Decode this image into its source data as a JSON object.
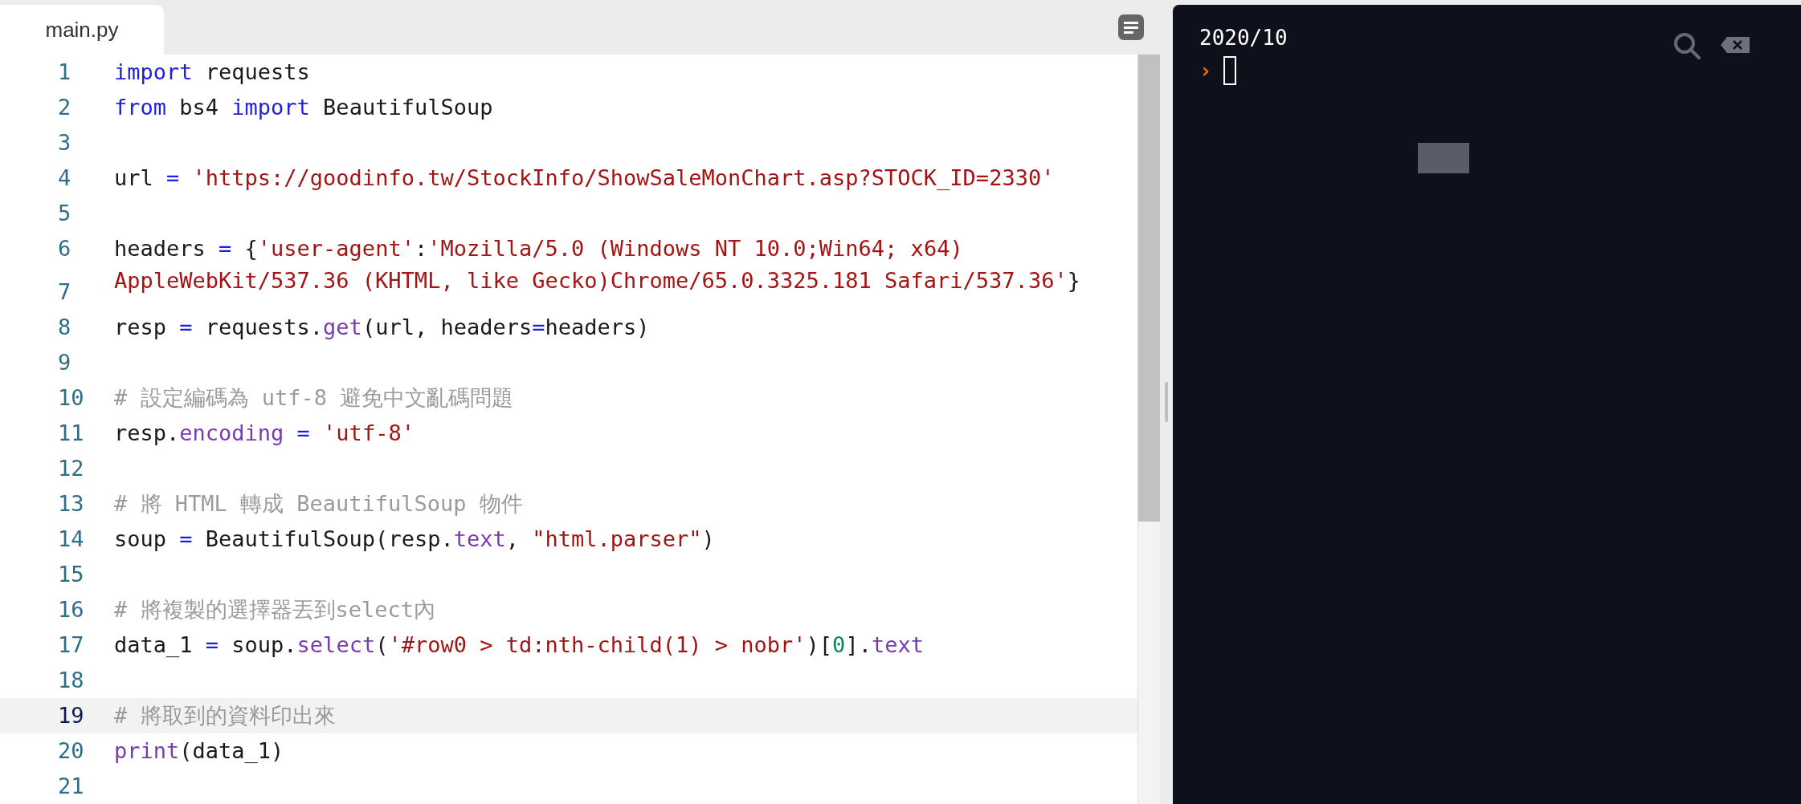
{
  "editor": {
    "tab": {
      "label": "main.py",
      "selected": true
    },
    "lines": [
      {
        "number": "1",
        "active": false,
        "tokens": [
          {
            "kind": "keyword",
            "text": "import"
          },
          {
            "kind": "plain",
            "text": " requests"
          }
        ]
      },
      {
        "number": "2",
        "active": false,
        "tokens": [
          {
            "kind": "keyword",
            "text": "from"
          },
          {
            "kind": "plain",
            "text": " bs4 "
          },
          {
            "kind": "keyword",
            "text": "import"
          },
          {
            "kind": "plain",
            "text": " BeautifulSoup"
          }
        ]
      },
      {
        "number": "3",
        "active": false
      },
      {
        "number": "4",
        "active": false,
        "tokens": [
          {
            "kind": "plain",
            "text": "url "
          },
          {
            "kind": "operator",
            "text": "="
          },
          {
            "kind": "string",
            "text": " 'https://goodinfo.tw/StockInfo/ShowSaleMonChart.asp?STOCK_ID=2330'"
          }
        ]
      },
      {
        "number": "5",
        "active": false
      },
      {
        "number": "6",
        "active": false,
        "tokens": [
          {
            "kind": "plain",
            "text": "headers "
          },
          {
            "kind": "operator",
            "text": "="
          },
          {
            "kind": "plain",
            "text": " {"
          },
          {
            "kind": "string",
            "text": "'user-agent'"
          },
          {
            "kind": "plain",
            "text": ":"
          },
          {
            "kind": "string",
            "text": "'Mozilla/5.0 (Windows NT 10.0;Win64; x64) AppleWebKit/537.36 (KHTML, like Gecko)Chrome/65.0.3325.181 Safari/537.36'"
          },
          {
            "kind": "plain",
            "text": "}"
          }
        ]
      },
      {
        "number": "7",
        "active": false
      },
      {
        "number": "8",
        "active": false,
        "tokens": [
          {
            "kind": "plain",
            "text": "resp "
          },
          {
            "kind": "operator",
            "text": "="
          },
          {
            "kind": "plain",
            "text": " requests."
          },
          {
            "kind": "property",
            "text": "get"
          },
          {
            "kind": "plain",
            "text": "(url, headers"
          },
          {
            "kind": "operator",
            "text": "="
          },
          {
            "kind": "plain",
            "text": "headers)"
          }
        ]
      },
      {
        "number": "9",
        "active": false
      },
      {
        "number": "10",
        "active": false,
        "tokens": [
          {
            "kind": "comment",
            "text": "# 設定編碼為 utf-8 避免中文亂碼問題"
          }
        ]
      },
      {
        "number": "11",
        "active": false,
        "tokens": [
          {
            "kind": "plain",
            "text": "resp."
          },
          {
            "kind": "property",
            "text": "encoding"
          },
          {
            "kind": "operator",
            "text": " = "
          },
          {
            "kind": "string",
            "text": "'utf-8'"
          }
        ]
      },
      {
        "number": "12",
        "active": false
      },
      {
        "number": "13",
        "active": false,
        "tokens": [
          {
            "kind": "comment",
            "text": "# 將 HTML 轉成 BeautifulSoup 物件"
          }
        ]
      },
      {
        "number": "14",
        "active": false,
        "tokens": [
          {
            "kind": "plain",
            "text": "soup "
          },
          {
            "kind": "operator",
            "text": "="
          },
          {
            "kind": "plain",
            "text": " BeautifulSoup(resp."
          },
          {
            "kind": "property",
            "text": "text"
          },
          {
            "kind": "plain",
            "text": ", "
          },
          {
            "kind": "string",
            "text": "\"html.parser\""
          },
          {
            "kind": "plain",
            "text": ")"
          }
        ]
      },
      {
        "number": "15",
        "active": false
      },
      {
        "number": "16",
        "active": false,
        "tokens": [
          {
            "kind": "comment",
            "text": "# 將複製的選擇器丟到select內"
          }
        ]
      },
      {
        "number": "17",
        "active": false,
        "tokens": [
          {
            "kind": "plain",
            "text": "data_1 "
          },
          {
            "kind": "operator",
            "text": "="
          },
          {
            "kind": "plain",
            "text": " soup."
          },
          {
            "kind": "property",
            "text": "select"
          },
          {
            "kind": "plain",
            "text": "("
          },
          {
            "kind": "string",
            "text": "'#row0 > td:nth-child(1) > nobr'"
          },
          {
            "kind": "plain",
            "text": ")["
          },
          {
            "kind": "number",
            "text": "0"
          },
          {
            "kind": "plain",
            "text": "]."
          },
          {
            "kind": "property",
            "text": "text"
          }
        ]
      },
      {
        "number": "18",
        "active": false
      },
      {
        "number": "19",
        "active": true,
        "tokens": [
          {
            "kind": "comment",
            "text": "# 將取到的資料印出來"
          }
        ]
      },
      {
        "number": "20",
        "active": false,
        "tokens": [
          {
            "kind": "property",
            "text": "print"
          },
          {
            "kind": "plain",
            "text": "(data_1)"
          }
        ]
      },
      {
        "number": "21",
        "active": false
      }
    ]
  },
  "console": {
    "output": "2020/10",
    "prompt": "›"
  }
}
